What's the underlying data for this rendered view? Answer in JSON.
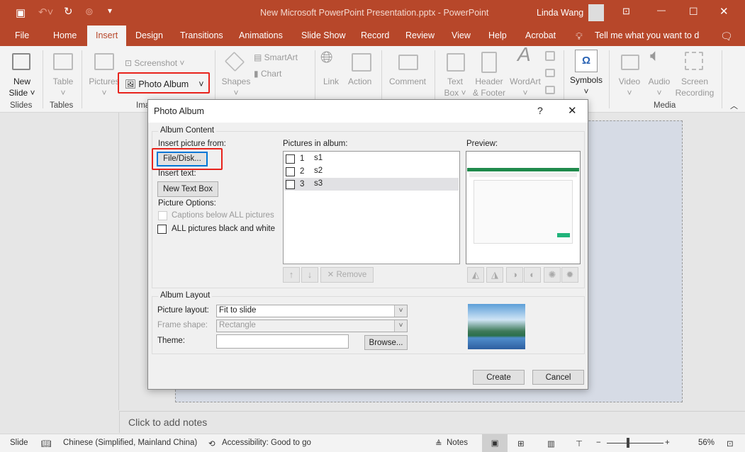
{
  "titlebar": {
    "title": "New Microsoft PowerPoint Presentation.pptx  -  PowerPoint",
    "user": "Linda Wang",
    "icons": [
      "save-icon",
      "undo-icon",
      "redo-icon",
      "present-icon",
      "customize-icon"
    ],
    "color": "#b7472a"
  },
  "tabs": [
    "File",
    "Home",
    "Insert",
    "Design",
    "Transitions",
    "Animations",
    "Slide Show",
    "Record",
    "Review",
    "View",
    "Help",
    "Acrobat"
  ],
  "active_tab": "Insert",
  "tell_me": "Tell me what you want to d",
  "ribbon": {
    "new_slide": [
      "New",
      "Slide ˅"
    ],
    "table": [
      "Table",
      "˅"
    ],
    "pictures": [
      "Pictures",
      "˅"
    ],
    "screenshot": "Screenshot ˅",
    "photo_album": "Photo Album",
    "shapes": [
      "Shapes",
      "˅"
    ],
    "smartart": "SmartArt",
    "chart": "Chart",
    "link": "Link",
    "action": "Action",
    "comment": "Comment",
    "text_box": [
      "Text",
      "Box ˅"
    ],
    "header_footer": [
      "Header",
      "& Footer"
    ],
    "wordart": [
      "WordArt",
      "˅"
    ],
    "symbols": [
      "Symbols",
      "˅"
    ],
    "video": [
      "Video",
      "˅"
    ],
    "audio": [
      "Audio",
      "˅"
    ],
    "screen_recording": [
      "Screen",
      "Recording"
    ],
    "groups": {
      "slides": "Slides",
      "tables": "Tables",
      "images": "Ima",
      "media": "Media"
    }
  },
  "notes_placeholder": "Click to add notes",
  "status": {
    "slide": "Slide",
    "language": "Chinese (Simplified, Mainland China)",
    "accessibility": "Accessibility: Good to go",
    "notes": "Notes",
    "zoom": "56%",
    "zoom_percent": 56
  },
  "dialog": {
    "title": "Photo Album",
    "help": "?",
    "close": "✕",
    "album_content": "Album Content",
    "insert_from": "Insert picture from:",
    "file_disk": "File/Disk...",
    "insert_text": "Insert text:",
    "new_text_box": "New Text Box",
    "picture_options": "Picture Options:",
    "captions": "Captions below ALL pictures",
    "black_white": "ALL pictures black and white",
    "pictures_label": "Pictures in album:",
    "pictures": [
      {
        "num": "1",
        "name": "s1"
      },
      {
        "num": "2",
        "name": "s2"
      },
      {
        "num": "3",
        "name": "s3",
        "selected": true
      }
    ],
    "remove": "Remove",
    "preview": "Preview:",
    "album_layout": "Album Layout",
    "picture_layout_label": "Picture layout:",
    "picture_layout": "Fit to slide",
    "frame_shape_label": "Frame shape:",
    "frame_shape": "Rectangle",
    "theme_label": "Theme:",
    "theme": "",
    "browse": "Browse...",
    "create": "Create",
    "cancel": "Cancel"
  }
}
